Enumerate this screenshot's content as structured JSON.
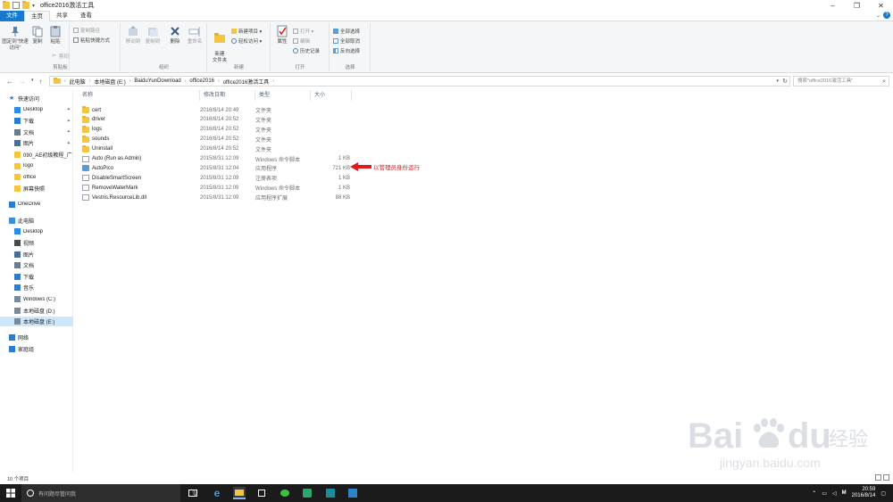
{
  "window": {
    "title": "office2016激活工具",
    "controls": [
      "minimize-icon",
      "maximize-icon",
      "close-icon"
    ]
  },
  "ribbon_tabs": [
    {
      "label": "文件",
      "style": "file"
    },
    {
      "label": "主页",
      "style": "active"
    },
    {
      "label": "共享",
      "style": "normal"
    },
    {
      "label": "查看",
      "style": "normal"
    }
  ],
  "ribbon": {
    "clipboard": {
      "label": "剪贴板",
      "pin": "固定到\"快速访问\"",
      "copy": "复制",
      "paste": "粘贴",
      "copy_path": "复制路径",
      "paste_shortcut": "粘贴快捷方式",
      "cut": "剪切"
    },
    "organize": {
      "label": "组织",
      "move_to": "移动到",
      "copy_to": "复制到",
      "delete": "删除",
      "rename": "重命名"
    },
    "new": {
      "label": "新建",
      "new_folder": "新建\n文件夹",
      "new_item": "新建项目 ▾",
      "easy_access": "轻松访问 ▾"
    },
    "open": {
      "label": "打开",
      "properties": "属性",
      "open": "打开 ▾",
      "edit": "编辑",
      "history": "历史记录"
    },
    "select": {
      "label": "选择",
      "select_all": "全部选择",
      "select_none": "全部取消",
      "invert": "反向选择"
    }
  },
  "address": {
    "crumbs": [
      "此电脑",
      "本地磁盘 (E:)",
      "BaiduYunDownload",
      "office2016",
      "office2016激活工具"
    ],
    "search_placeholder": "搜索\"office2016激活工具\""
  },
  "nav_pane": {
    "items": [
      {
        "label": "快速访问",
        "icon": "star-icon",
        "color": "#2b7cd3",
        "indent": 0,
        "pinned": false
      },
      {
        "label": "Desktop",
        "icon": "desktop-icon",
        "color": "#2b8de0",
        "indent": 1,
        "pinned": true
      },
      {
        "label": "下载",
        "icon": "download-icon",
        "color": "#2b7cd3",
        "indent": 1,
        "pinned": true
      },
      {
        "label": "文档",
        "icon": "document-icon",
        "color": "#6b7b8c",
        "indent": 1,
        "pinned": true
      },
      {
        "label": "图片",
        "icon": "picture-icon",
        "color": "#4a6f96",
        "indent": 1,
        "pinned": true
      },
      {
        "label": "090_AE初级教程_广",
        "icon": "folder-icon",
        "color": "#f4c542",
        "indent": 1,
        "pinned": false
      },
      {
        "label": "logo",
        "icon": "folder-icon",
        "color": "#f4c542",
        "indent": 1,
        "pinned": false
      },
      {
        "label": "office",
        "icon": "folder-icon",
        "color": "#f4c542",
        "indent": 1,
        "pinned": false
      },
      {
        "label": "屏幕快照",
        "icon": "folder-icon",
        "color": "#f4c542",
        "indent": 1,
        "pinned": false
      },
      {
        "label": "OneDrive",
        "icon": "cloud-icon",
        "color": "#2b7cd3",
        "indent": 0,
        "pinned": false
      },
      {
        "label": "此电脑",
        "icon": "computer-icon",
        "color": "#3c8ed8",
        "indent": 0,
        "pinned": false
      },
      {
        "label": "Desktop",
        "icon": "desktop-icon",
        "color": "#2b8de0",
        "indent": 1,
        "pinned": false
      },
      {
        "label": "视频",
        "icon": "video-icon",
        "color": "#4a4a4a",
        "indent": 1,
        "pinned": false
      },
      {
        "label": "图片",
        "icon": "picture-icon",
        "color": "#4a6f96",
        "indent": 1,
        "pinned": false
      },
      {
        "label": "文档",
        "icon": "document-icon",
        "color": "#6b7b8c",
        "indent": 1,
        "pinned": false
      },
      {
        "label": "下载",
        "icon": "download-icon",
        "color": "#2b7cd3",
        "indent": 1,
        "pinned": false
      },
      {
        "label": "音乐",
        "icon": "music-icon",
        "color": "#2b7cd3",
        "indent": 1,
        "pinned": false
      },
      {
        "label": "Windows (C:)",
        "icon": "drive-icon",
        "color": "#7a8a9a",
        "indent": 1,
        "pinned": false
      },
      {
        "label": "本地磁盘 (D:)",
        "icon": "drive-icon",
        "color": "#7a8a9a",
        "indent": 1,
        "pinned": false
      },
      {
        "label": "本地磁盘 (E:)",
        "icon": "drive-icon",
        "color": "#7a8a9a",
        "indent": 1,
        "pinned": false,
        "selected": true
      },
      {
        "label": "网络",
        "icon": "network-icon",
        "color": "#2b7cd3",
        "indent": 0,
        "pinned": false
      },
      {
        "label": "家庭组",
        "icon": "homegroup-icon",
        "color": "#2b7cd3",
        "indent": 0,
        "pinned": false
      }
    ]
  },
  "columns": [
    "名称",
    "修改日期",
    "类型",
    "大小"
  ],
  "files": [
    {
      "name": "cert",
      "date": "2016/8/14 20:49",
      "type": "文件夹",
      "size": "",
      "kind": "folder"
    },
    {
      "name": "driver",
      "date": "2016/8/14 20:52",
      "type": "文件夹",
      "size": "",
      "kind": "folder"
    },
    {
      "name": "logs",
      "date": "2016/8/14 20:52",
      "type": "文件夹",
      "size": "",
      "kind": "folder"
    },
    {
      "name": "sounds",
      "date": "2016/8/14 20:52",
      "type": "文件夹",
      "size": "",
      "kind": "folder"
    },
    {
      "name": "Uninstall",
      "date": "2016/8/14 20:52",
      "type": "文件夹",
      "size": "",
      "kind": "folder"
    },
    {
      "name": "Auto (Run as Admin)",
      "date": "2015/8/31 12:09",
      "type": "Windows 命令脚本",
      "size": "1 KB",
      "kind": "script"
    },
    {
      "name": "AutoPico",
      "date": "2015/8/31 12:04",
      "type": "应用程序",
      "size": "721 KB",
      "kind": "exe"
    },
    {
      "name": "DisableSmartScreen",
      "date": "2015/8/31 12:09",
      "type": "注册表项",
      "size": "1 KB",
      "kind": "reg"
    },
    {
      "name": "RemoveWaterMark",
      "date": "2015/8/31 12:09",
      "type": "Windows 命令脚本",
      "size": "1 KB",
      "kind": "script"
    },
    {
      "name": "Vestris.ResourceLib.dll",
      "date": "2015/8/31 12:09",
      "type": "应用程序扩展",
      "size": "88 KB",
      "kind": "dll"
    }
  ],
  "annotation": {
    "text": "以管理员身份运行",
    "color": "#e0191b"
  },
  "status": {
    "item_count": "10 个项目"
  },
  "watermark": {
    "brand": "Bai",
    "brand2": "du",
    "suffix": "经验",
    "url": "jingyan.baidu.com"
  },
  "taskbar": {
    "search_placeholder": "有问题尽管问我",
    "time": "20:59",
    "date": "2016/8/14",
    "ime": "M"
  }
}
